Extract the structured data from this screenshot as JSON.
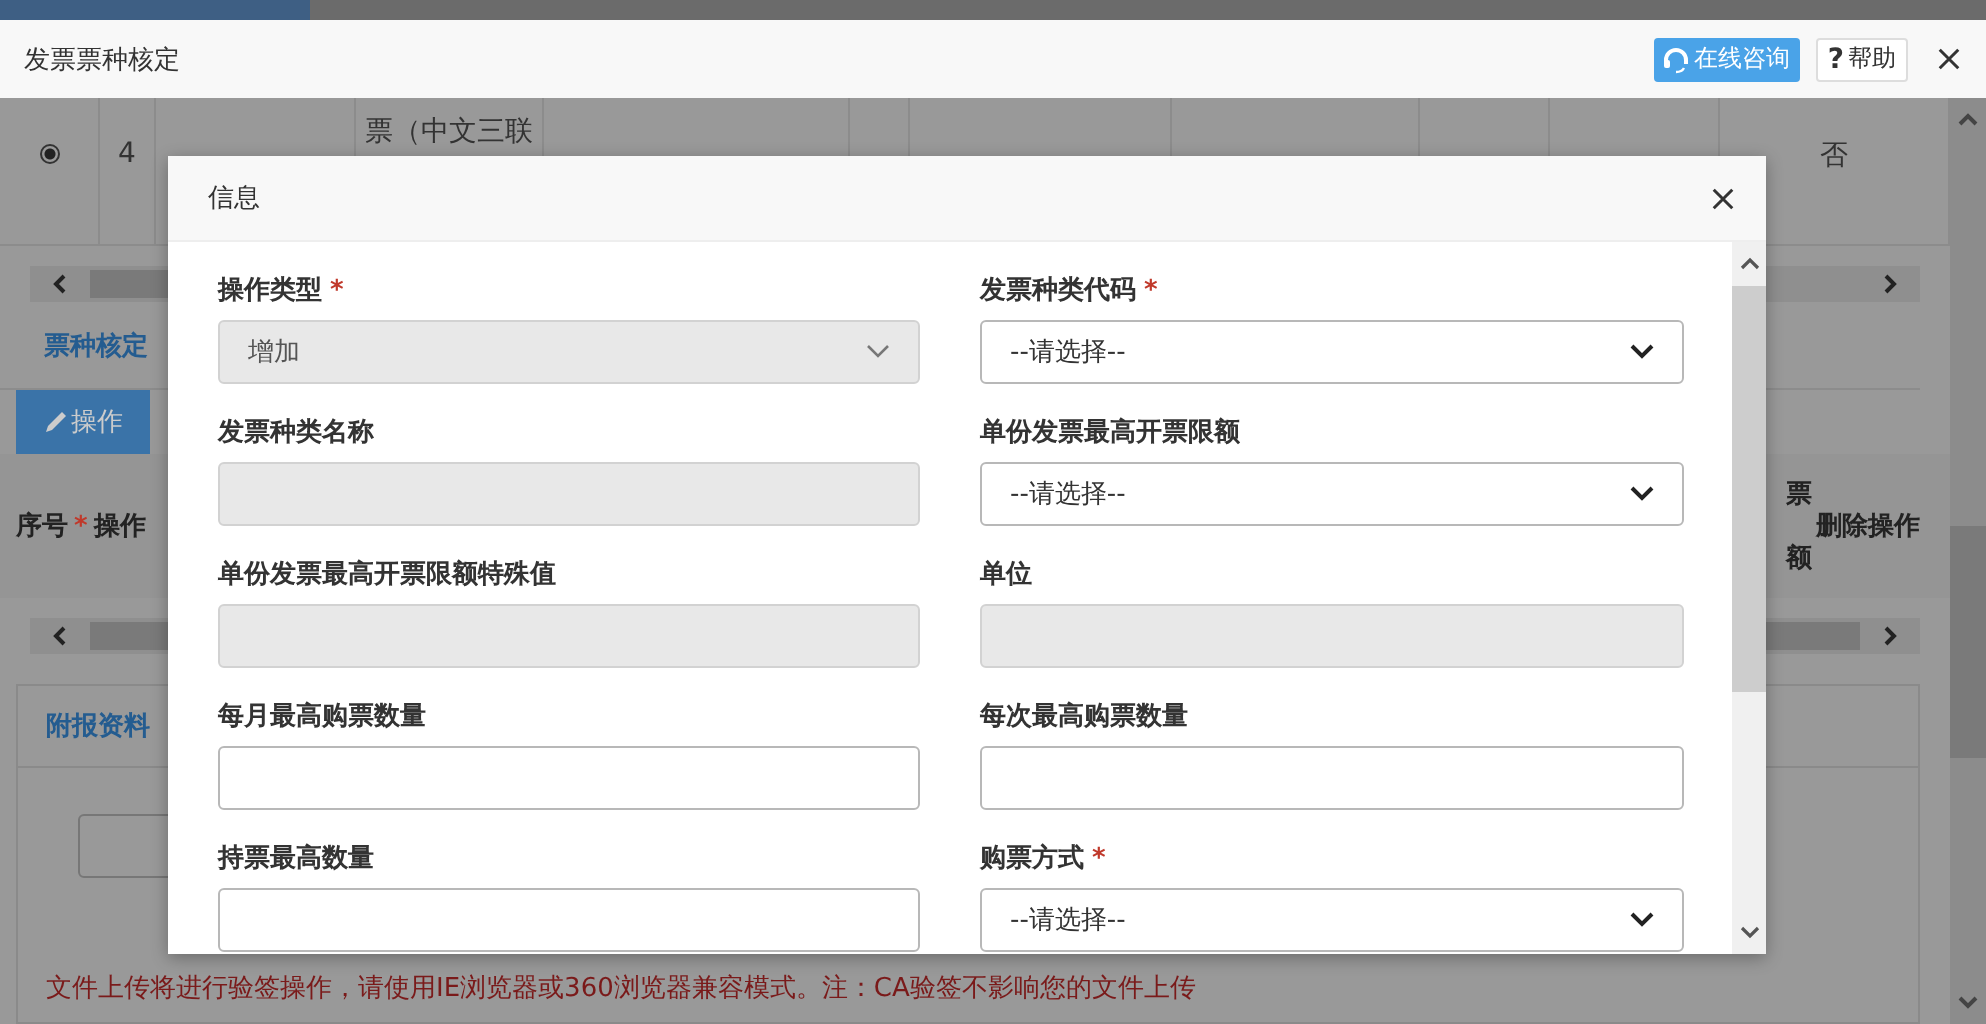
{
  "window": {
    "title": "发票票种核定",
    "buttons": [
      {
        "kind": "consult",
        "label": "在线咨询"
      },
      {
        "kind": "help",
        "icon": "?",
        "label": "帮助"
      }
    ]
  },
  "background": {
    "table_row": {
      "selected": true,
      "cells": [
        "4",
        "票（中文三联",
        "否"
      ]
    },
    "section_title": "票种核定",
    "action_button": "操作",
    "detail_headers": [
      {
        "label": "序号",
        "required_mark": "*"
      },
      {
        "label": "操作"
      }
    ],
    "detail_headers_right": [
      "票",
      "额",
      "删除操作"
    ],
    "attachments_title": "附报资料",
    "notice": "文件上传将进行验签操作，请使用IE浏览器或360浏览器兼容模式。注：CA验签不影响您的文件上传"
  },
  "modal": {
    "title": "信息",
    "fields": [
      {
        "label": "操作类型",
        "required_mark": "*",
        "kind": "select",
        "value": "增加",
        "disabled": true
      },
      {
        "label": "发票种类代码",
        "required_mark": "*",
        "kind": "select",
        "value": "--请选择--",
        "disabled": false
      },
      {
        "label": "发票种类名称",
        "kind": "text",
        "disabled": true
      },
      {
        "label": "单份发票最高开票限额",
        "kind": "select",
        "value": "--请选择--",
        "disabled": false
      },
      {
        "label": "单份发票最高开票限额特殊值",
        "kind": "text",
        "disabled": true
      },
      {
        "label": "单位",
        "kind": "text",
        "disabled": true
      },
      {
        "label": "每月最高购票数量",
        "kind": "text",
        "disabled": false
      },
      {
        "label": "每次最高购票数量",
        "kind": "text",
        "disabled": false
      },
      {
        "label": "持票最高数量",
        "kind": "text",
        "disabled": false
      },
      {
        "label": "购票方式",
        "required_mark": "*",
        "kind": "select",
        "value": "--请选择--",
        "disabled": false
      }
    ]
  }
}
